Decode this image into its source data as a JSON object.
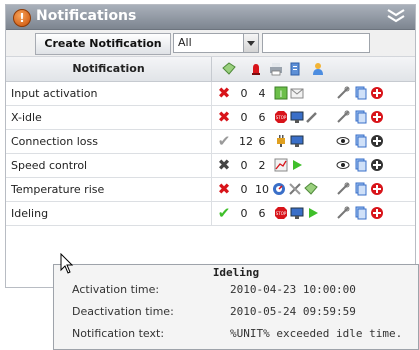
{
  "header": {
    "title": "Notifications"
  },
  "toolbar": {
    "create_label": "Create Notification",
    "filter_selected": "All",
    "search_value": ""
  },
  "table": {
    "column_name": "Notification",
    "rows": [
      {
        "name": "Input activation",
        "status": "error",
        "count_a": "0",
        "count_b": "4"
      },
      {
        "name": "X-idle",
        "status": "error",
        "count_a": "0",
        "count_b": "6"
      },
      {
        "name": "Connection loss",
        "status": "ok-grey",
        "count_a": "12",
        "count_b": "6"
      },
      {
        "name": "Speed control",
        "status": "disabled",
        "count_a": "0",
        "count_b": "2"
      },
      {
        "name": "Temperature rise",
        "status": "error",
        "count_a": "0",
        "count_b": "10"
      },
      {
        "name": "Ideling",
        "status": "ok",
        "count_a": "0",
        "count_b": "6"
      }
    ]
  },
  "tooltip": {
    "title": "Ideling",
    "activation_label": "Activation time:",
    "activation_value": "2010-04-23 10:00:00",
    "deactivation_label": "Deactivation time:",
    "deactivation_value": "2010-05-24 09:59:59",
    "text_label": "Notification text:",
    "text_value": "%UNIT% exceeded idle time."
  },
  "colors": {
    "error": "#d8141a",
    "ok": "#3fbf2a",
    "grey": "#888888",
    "dark": "#444444",
    "accent_blue": "#3a6fc8"
  }
}
